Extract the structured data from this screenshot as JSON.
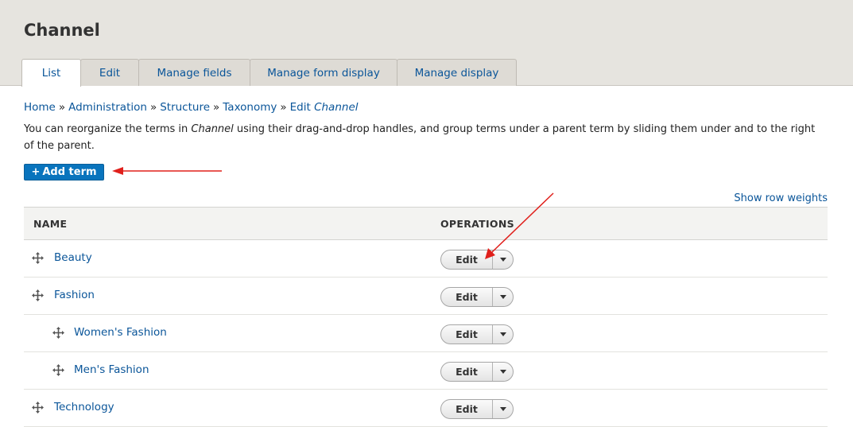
{
  "page": {
    "title": "Channel"
  },
  "tabs": [
    {
      "label": "List",
      "active": true
    },
    {
      "label": "Edit",
      "active": false
    },
    {
      "label": "Manage fields",
      "active": false
    },
    {
      "label": "Manage form display",
      "active": false
    },
    {
      "label": "Manage display",
      "active": false
    }
  ],
  "breadcrumb": {
    "items": [
      "Home",
      "Administration",
      "Structure",
      "Taxonomy"
    ],
    "separator": "»",
    "current_prefix": "Edit",
    "current_name": "Channel"
  },
  "description": {
    "before": "You can reorganize the terms in ",
    "vocabulary": "Channel",
    "after": " using their drag-and-drop handles, and group terms under a parent term by sliding them under and to the right of the parent."
  },
  "actions": {
    "add_term_label": "Add term",
    "add_term_icon": "plus-icon",
    "show_row_weights": "Show row weights"
  },
  "table": {
    "headers": {
      "name": "NAME",
      "operations": "OPERATIONS"
    },
    "rows": [
      {
        "name": "Beauty",
        "depth": 0,
        "operation": "Edit"
      },
      {
        "name": "Fashion",
        "depth": 0,
        "operation": "Edit"
      },
      {
        "name": "Women's Fashion",
        "depth": 1,
        "operation": "Edit"
      },
      {
        "name": "Men's Fashion",
        "depth": 1,
        "operation": "Edit"
      },
      {
        "name": "Technology",
        "depth": 0,
        "operation": "Edit"
      }
    ]
  },
  "colors": {
    "link": "#0a5599",
    "primary_button": "#0974bd",
    "annotation_arrow": "#e0201c",
    "header_bg": "#e6e4df"
  }
}
